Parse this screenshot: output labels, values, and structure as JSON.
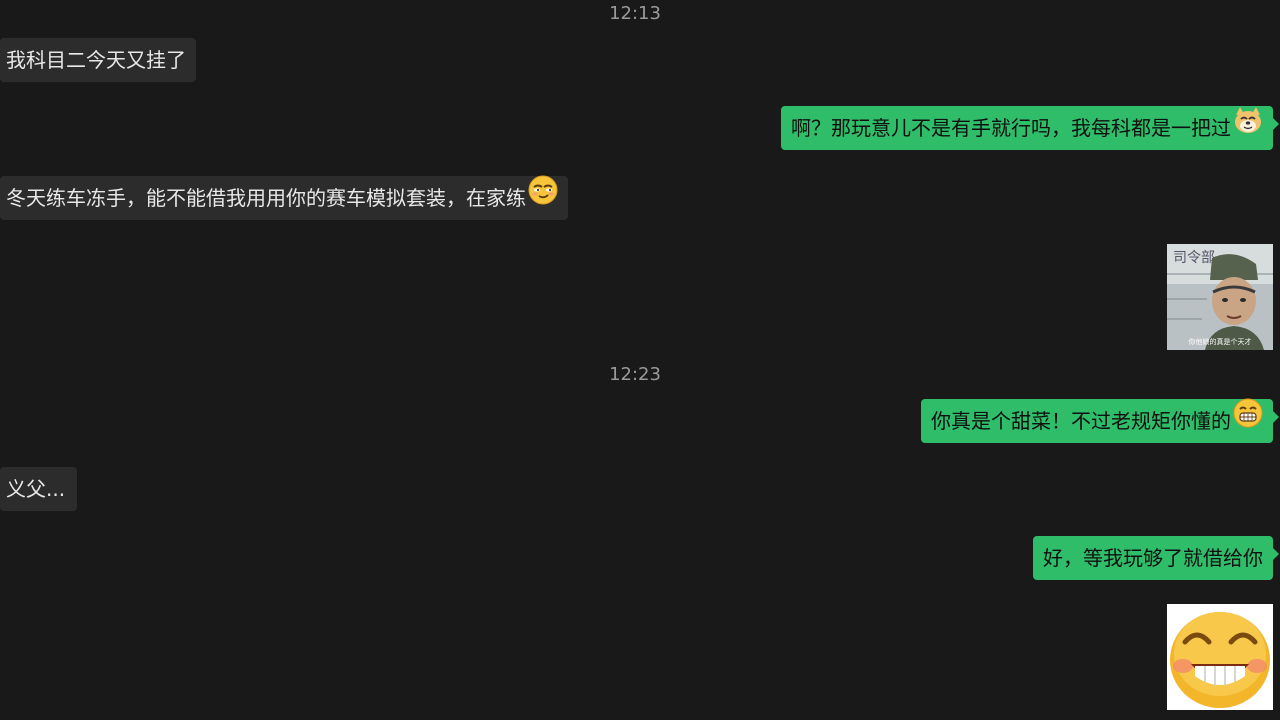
{
  "timestamps": [
    "12:13",
    "12:23"
  ],
  "messages": {
    "m1": "我科目二今天又挂了",
    "m2": "啊？那玩意儿不是有手就行吗，我每科都是一把过",
    "m3": "冬天练车冻手，能不能借我用用你的赛车模拟套装，在家练",
    "m5": "你真是个甜菜！不过老规矩你懂的",
    "m6": "义父...",
    "m7": "好，等我玩够了就借给你"
  },
  "sticker_text": {
    "top": "司令部",
    "bottom": "你他娘的真是个天才"
  },
  "colors": {
    "background": "#191919",
    "incoming_bubble": "#2c2c2c",
    "outgoing_bubble": "#2fbd6a"
  }
}
